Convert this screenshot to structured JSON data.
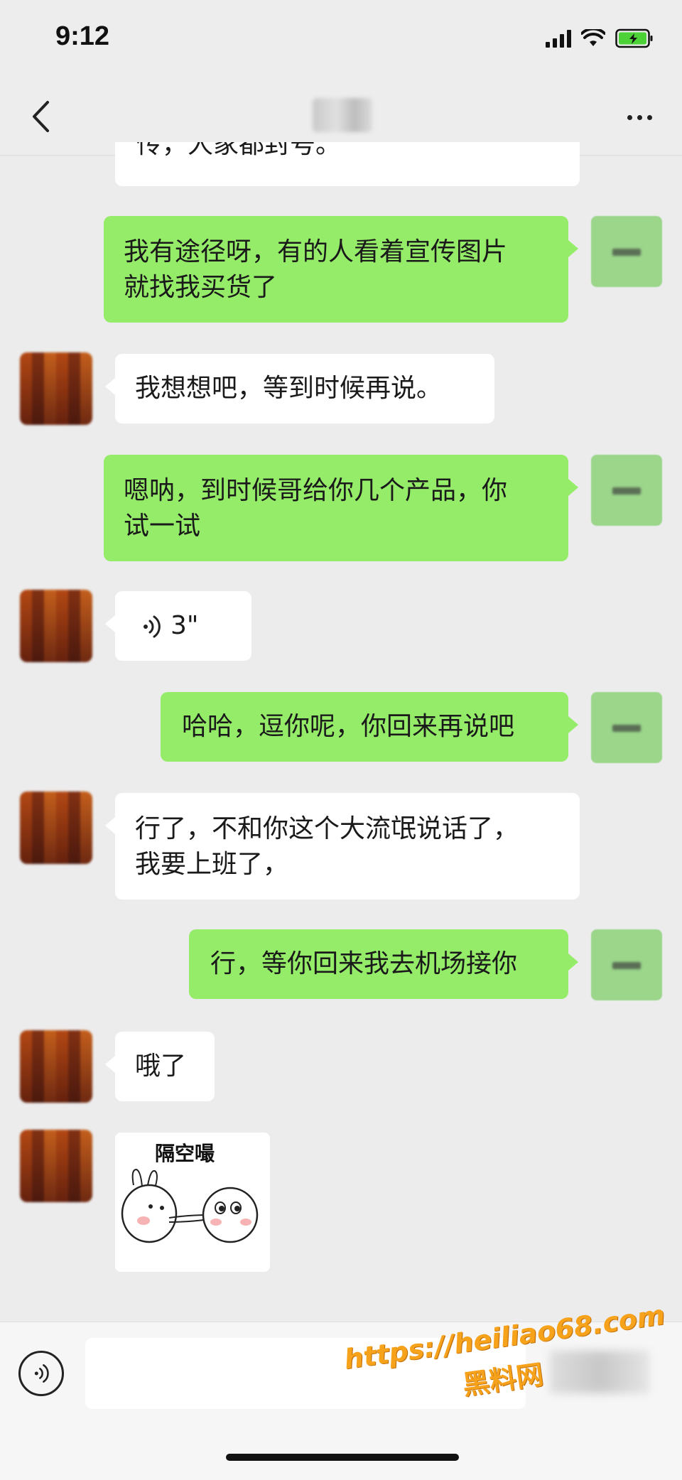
{
  "status_bar": {
    "time": "9:12"
  },
  "nav": {
    "back_icon": "chevron-left-icon",
    "more_icon": "more-horizontal-icon"
  },
  "messages": [
    {
      "side": "in",
      "partial": true,
      "text": "传，人家都封号。"
    },
    {
      "side": "out",
      "lines": [
        "我有途径呀，有的人看着宣传图片",
        "就找我买货了"
      ]
    },
    {
      "side": "in",
      "lines": [
        "我想想吧，等到时候再说。"
      ]
    },
    {
      "side": "out",
      "lines": [
        "嗯呐，到时候哥给你几个产品，你",
        "试一试"
      ]
    },
    {
      "side": "in",
      "type": "voice",
      "duration": "3\""
    },
    {
      "side": "out",
      "lines": [
        "哈哈，逗你呢，你回来再说吧"
      ]
    },
    {
      "side": "in",
      "lines": [
        "行了，不和你这个大流氓说话了，",
        "我要上班了，"
      ]
    },
    {
      "side": "out",
      "lines": [
        "行，等你回来我去机场接你"
      ]
    },
    {
      "side": "in",
      "lines": [
        "哦了"
      ]
    },
    {
      "side": "in",
      "type": "sticker",
      "caption": "隔空嘬"
    }
  ],
  "input": {
    "value": "",
    "voice_icon": "voice-input-icon"
  },
  "watermark": {
    "url": "https://heiliao68.com",
    "name": "黑料网"
  },
  "colors": {
    "background": "#ececec",
    "outgoing_bubble": "#95ec69",
    "incoming_bubble": "#ffffff",
    "watermark": "#f7a21b"
  }
}
